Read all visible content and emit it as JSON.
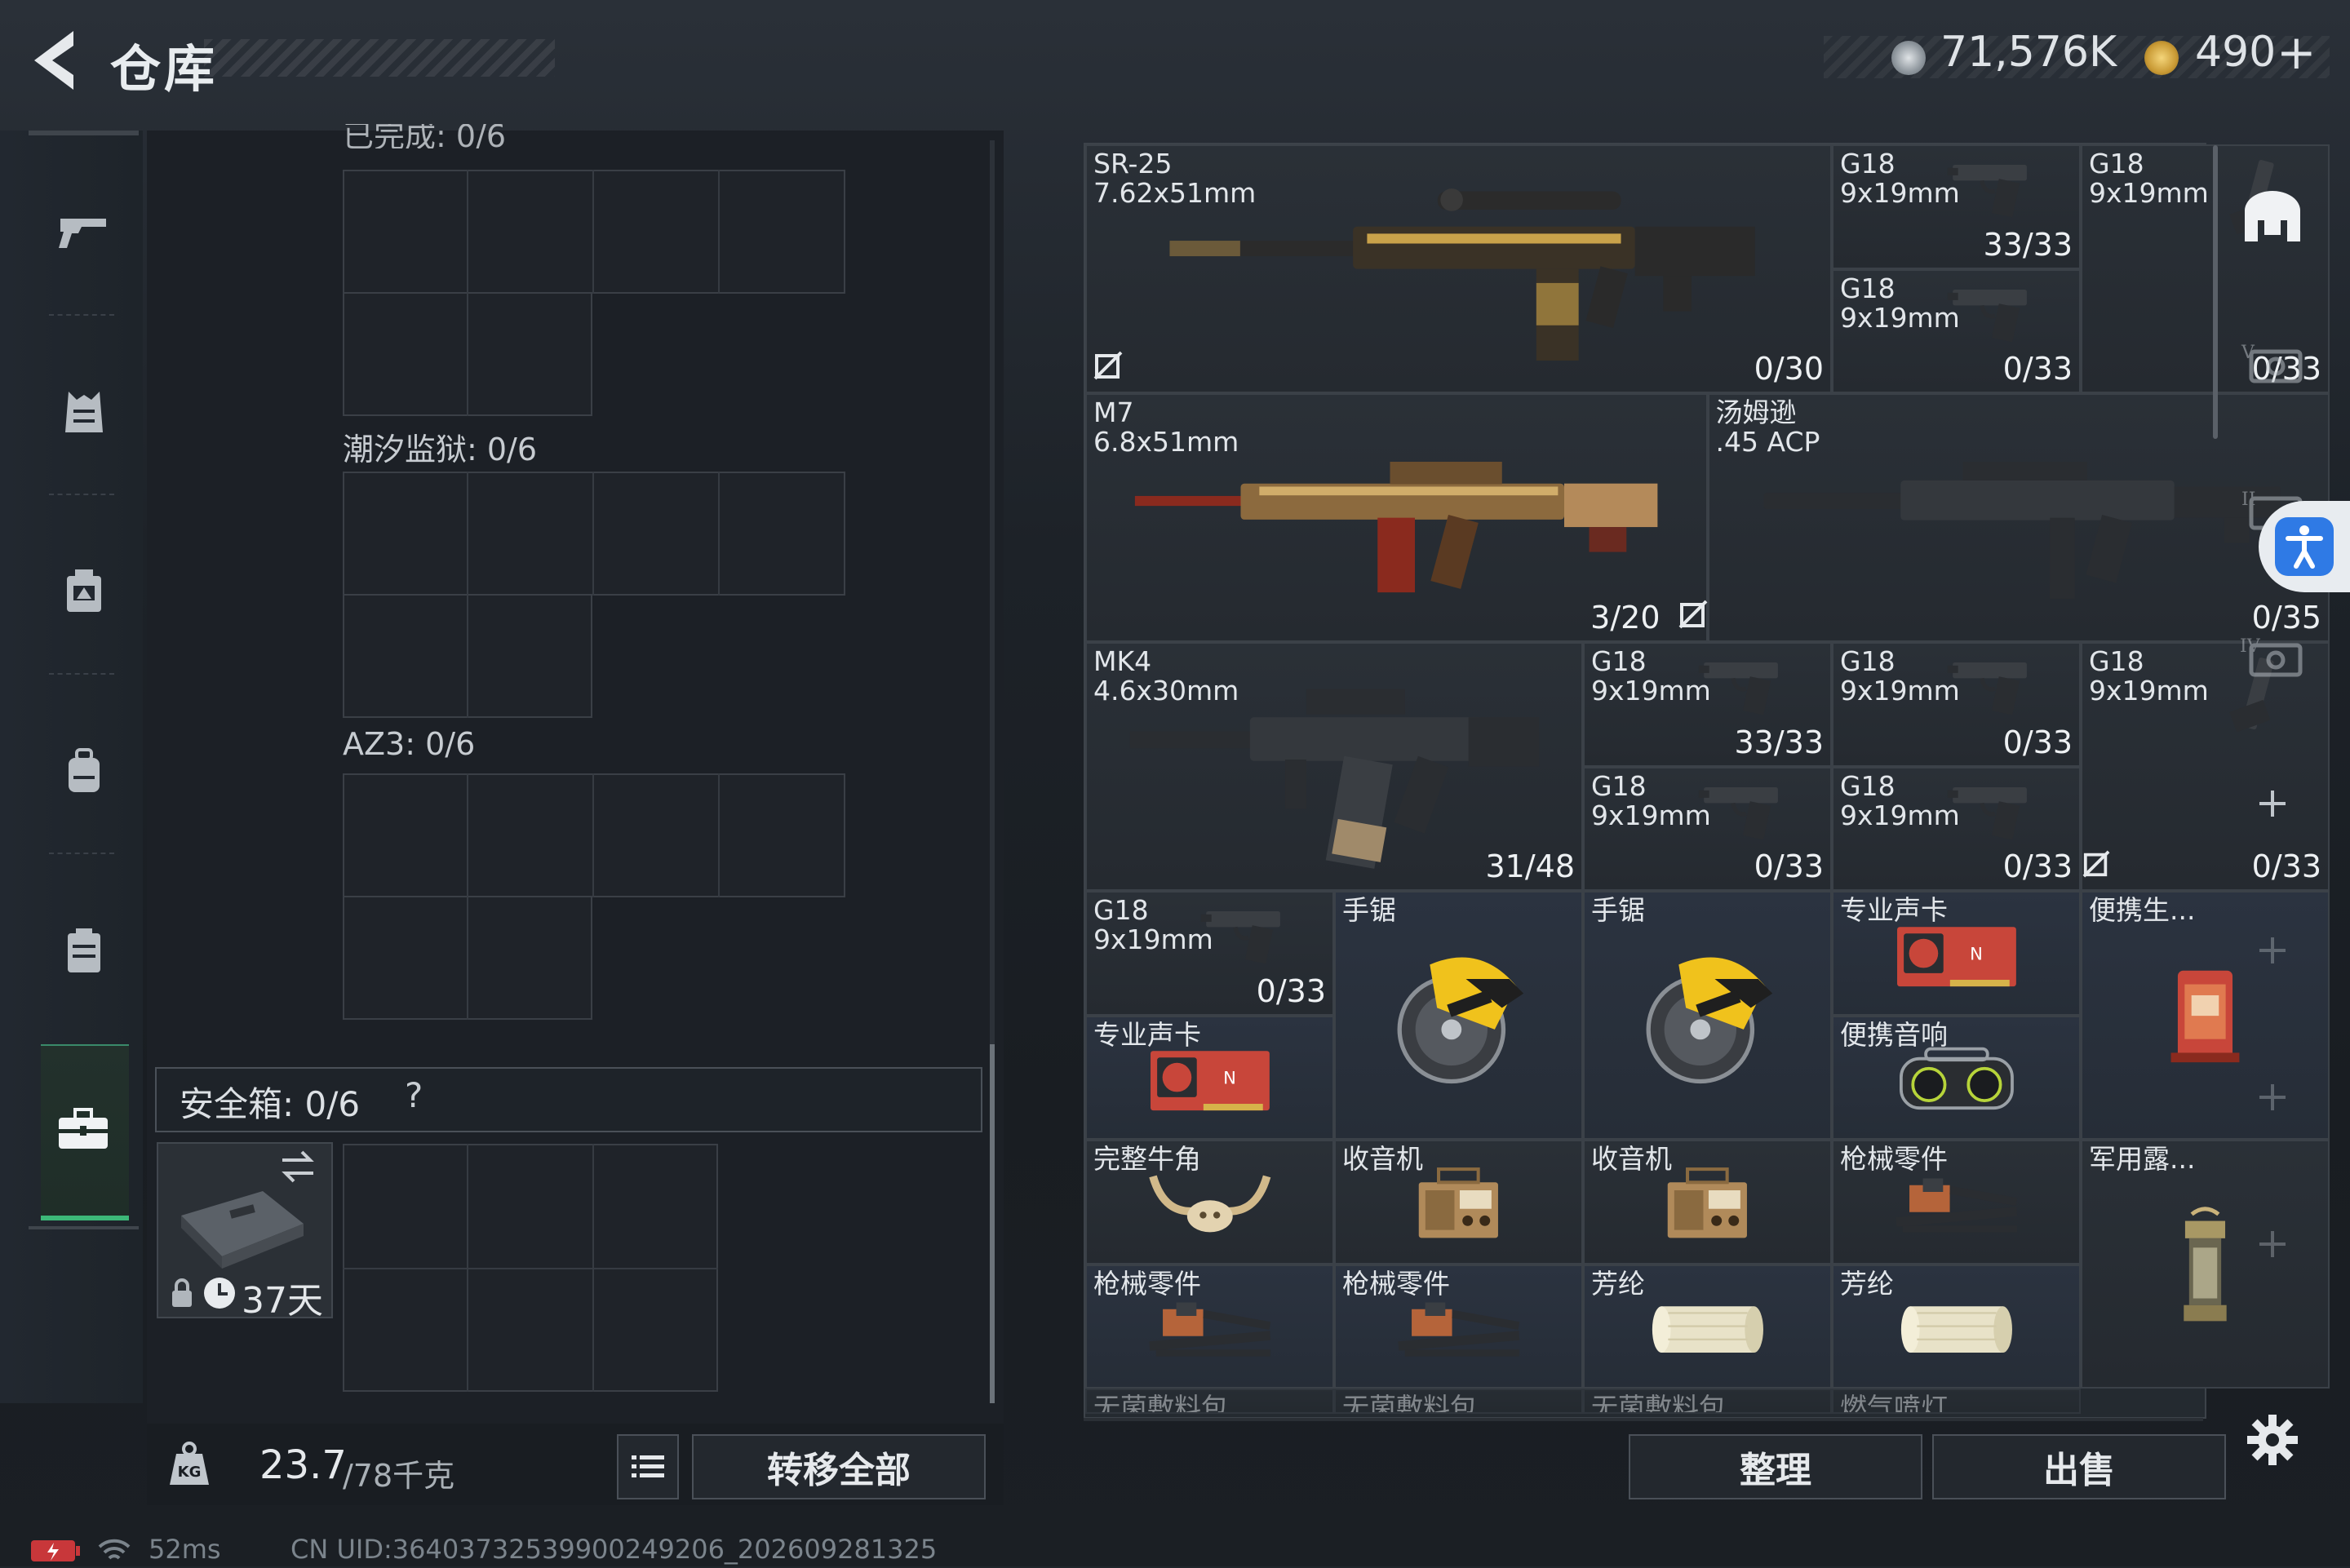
{
  "header": {
    "title": "仓库",
    "currency": [
      {
        "icon": "silver-coin-icon",
        "value": "71,576K"
      },
      {
        "icon": "gold-coin-icon",
        "value": "490"
      }
    ],
    "add_label": "+"
  },
  "sidebar": {
    "items": [
      {
        "name": "weapon",
        "icon": "gun-icon"
      },
      {
        "name": "armor",
        "icon": "vest-icon"
      },
      {
        "name": "chest-rig",
        "icon": "chest-rig-icon"
      },
      {
        "name": "backpack",
        "icon": "backpack-icon"
      },
      {
        "name": "container",
        "icon": "pouch-icon"
      },
      {
        "name": "safe-case",
        "icon": "briefcase-icon",
        "active": true
      }
    ]
  },
  "containers": {
    "top_cut_label": "已完成: 0/6",
    "sections": [
      {
        "label": "潮汐监狱: 0/6"
      },
      {
        "label": "AZ3: 0/6"
      }
    ],
    "safe_box": {
      "label": "安全箱: 0/6",
      "help": "?",
      "days": "37天"
    }
  },
  "footer": {
    "weight_current": "23.7",
    "weight_max": "/78千克",
    "transfer_all": "转移全部",
    "sort": "整理",
    "sell": "出售"
  },
  "status": {
    "ping": "52ms",
    "uid": "CN UID:36403732539900249206_202609281325"
  },
  "inventory": {
    "sr25": {
      "name": "SR-25\n7.62x51mm",
      "count": "0/30"
    },
    "g18_a": {
      "name": "G18\n9x19mm",
      "count": "33/33"
    },
    "g18_b": {
      "name": "G18\n9x19mm",
      "count": "0/33"
    },
    "g18_c": {
      "name": "G18\n9x19mm",
      "count": "0/33"
    },
    "m7": {
      "name": "M7\n6.8x51mm",
      "count": "3/20"
    },
    "thompson": {
      "name": "汤姆逊\n.45 ACP",
      "count": "0/35"
    },
    "mk4": {
      "name": "MK4\n4.6x30mm",
      "count": "31/48"
    },
    "g18_d": {
      "name": "G18\n9x19mm",
      "count": "33/33"
    },
    "g18_e": {
      "name": "G18\n9x19mm",
      "count": "0/33"
    },
    "g18_f": {
      "name": "G18\n9x19mm",
      "count": "0/33"
    },
    "g18_g": {
      "name": "G18\n9x19mm",
      "count": "0/33"
    },
    "g18_h": {
      "name": "G18\n9x19mm",
      "count": "0/33"
    },
    "g18_i": {
      "name": "G18\n9x19mm",
      "count": "0/33"
    },
    "saw1": {
      "name": "手锯"
    },
    "saw2": {
      "name": "手锯"
    },
    "soundcard1": {
      "name": "专业声卡"
    },
    "soundcard2": {
      "name": "专业声卡"
    },
    "portable_gen": {
      "name": "便携生..."
    },
    "portable_speaker": {
      "name": "便携音响"
    },
    "horn": {
      "name": "完整牛角"
    },
    "radio1": {
      "name": "收音机"
    },
    "radio2": {
      "name": "收音机"
    },
    "gunparts1": {
      "name": "枪械零件"
    },
    "gunparts2": {
      "name": "枪械零件"
    },
    "gunparts3": {
      "name": "枪械零件"
    },
    "lantern": {
      "name": "军用露..."
    },
    "aramid1": {
      "name": "芳纶"
    },
    "aramid2": {
      "name": "芳纶"
    },
    "bandage1": {
      "name": "无菌敷料包"
    },
    "bandage2": {
      "name": "无菌敷料包"
    },
    "bandage3": {
      "name": "无菌敷料包"
    },
    "torch": {
      "name": "燃气喷灯"
    }
  },
  "colors": {
    "accent_green": "#3cb878",
    "brand_blue": "#2f7ae5",
    "panel_bg": "#1c2026"
  }
}
